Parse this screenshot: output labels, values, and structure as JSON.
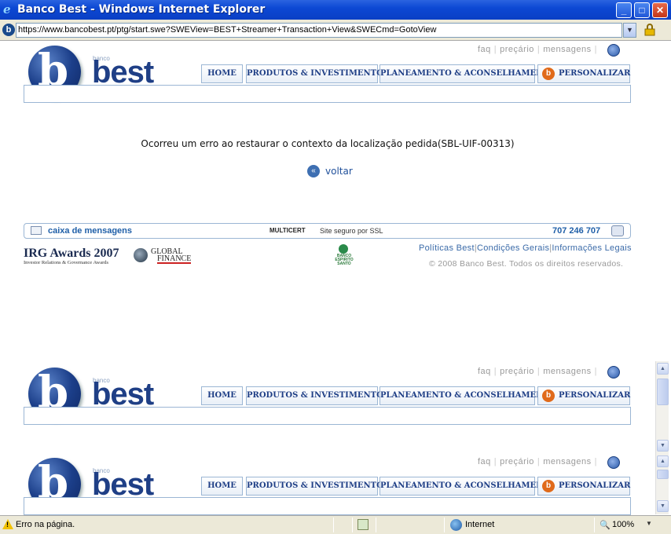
{
  "window": {
    "title": "Banco Best - Windows Internet Explorer",
    "url": "https://www.bancobest.pt/ptg/start.swe?SWEView=BEST+Streamer+Transaction+View&SWECmd=GotoView"
  },
  "header": {
    "logo_small": "banco",
    "logo_text": "best",
    "toplinks": [
      "faq",
      "preçário",
      "mensagens"
    ],
    "nav": {
      "home": "HOME",
      "produtos": "PRODUTOS & INVESTIMENTOS",
      "planeamento": "PLANEAMENTO & ACONSELHAMENTO",
      "personalizar": "PERSONALIZAR"
    }
  },
  "main": {
    "error_message": "Ocorreu um erro ao restaurar o contexto da localização pedida(SBL-UIF-00313)",
    "back_label": "voltar"
  },
  "footer": {
    "caixa": "caixa de mensagens",
    "multicert": "MULTICERT",
    "ssl_text": "Site seguro por SSL",
    "phone": "707 246 707",
    "irg_title": "IRG Awards 2007",
    "irg_subtitle": "Investor Relations & Governance Awards",
    "global_finance_1": "GLOBAL",
    "global_finance_2": "FINANCE",
    "bes_text": "BANCO ESPIRITO SANTO",
    "legal_links": [
      "Políticas Best",
      "Condições Gerais",
      "Informações Legais"
    ],
    "copyright": "© 2008 Banco Best. Todos os direitos reservados."
  },
  "statusbar": {
    "status": "Erro na página.",
    "zone": "Internet",
    "zoom": "100%"
  }
}
